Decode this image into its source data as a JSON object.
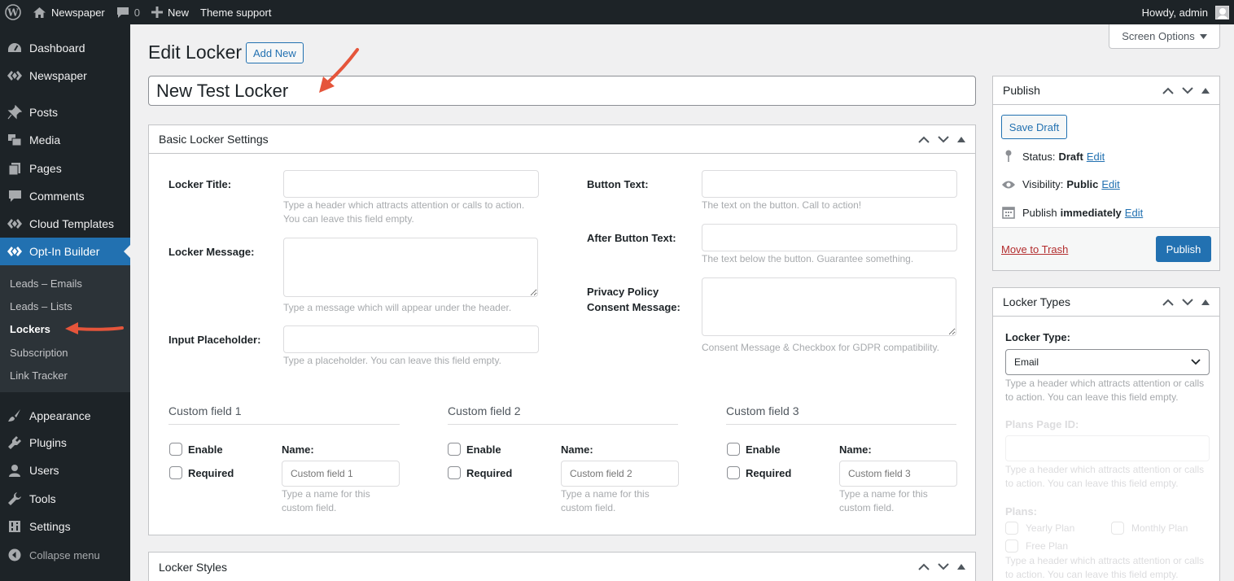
{
  "adminbar": {
    "site_name": "Newspaper",
    "comments_count": "0",
    "new_label": "New",
    "theme_support": "Theme support",
    "howdy": "Howdy, admin"
  },
  "sidebar": {
    "items": [
      {
        "label": "Dashboard",
        "icon": "dashboard-icon"
      },
      {
        "label": "Newspaper",
        "icon": "newspaper-icon"
      },
      {
        "label": "Posts",
        "icon": "pin-icon"
      },
      {
        "label": "Media",
        "icon": "media-icon"
      },
      {
        "label": "Pages",
        "icon": "pages-icon"
      },
      {
        "label": "Comments",
        "icon": "comment-icon"
      },
      {
        "label": "Cloud Templates",
        "icon": "cloud-templates-icon"
      },
      {
        "label": "Opt-In Builder",
        "icon": "optin-icon"
      },
      {
        "label": "Appearance",
        "icon": "brush-icon"
      },
      {
        "label": "Plugins",
        "icon": "plugin-icon"
      },
      {
        "label": "Users",
        "icon": "users-icon"
      },
      {
        "label": "Tools",
        "icon": "wrench-icon"
      },
      {
        "label": "Settings",
        "icon": "settings-icon"
      }
    ],
    "submenu": [
      "Leads – Emails",
      "Leads – Lists",
      "Lockers",
      "Subscription",
      "Link Tracker"
    ],
    "collapse": "Collapse menu"
  },
  "header": {
    "title": "Edit Locker",
    "add_new": "Add New",
    "screen_options": "Screen Options"
  },
  "post_title": "New Test Locker",
  "basic": {
    "title": "Basic Locker Settings",
    "locker_title": {
      "label": "Locker Title:",
      "hint1": "Type a header which attracts attention or calls to action.",
      "hint2": "You can leave this field empty."
    },
    "locker_message": {
      "label": "Locker Message:",
      "hint": "Type a message which will appear under the header."
    },
    "input_placeholder": {
      "label": "Input Placeholder:",
      "hint": "Type a placeholder. You can leave this field empty."
    },
    "button_text": {
      "label": "Button Text:",
      "hint": "The text on the button. Call to action!"
    },
    "after_button": {
      "label": "After Button Text:",
      "hint": "The text below the button. Guarantee something."
    },
    "privacy": {
      "label1": "Privacy Policy",
      "label2": "Consent Message:",
      "hint": "Consent Message & Checkbox for GDPR compatibility."
    },
    "custom_fields": [
      {
        "title": "Custom field 1",
        "placeholder": "Custom field 1"
      },
      {
        "title": "Custom field 2",
        "placeholder": "Custom field 2"
      },
      {
        "title": "Custom field 3",
        "placeholder": "Custom field 3"
      }
    ],
    "enable": "Enable",
    "required": "Required",
    "name": "Name:",
    "name_hint1": "Type a name for this",
    "name_hint2": "custom field."
  },
  "styles": {
    "title": "Locker Styles"
  },
  "publish": {
    "title": "Publish",
    "save_draft": "Save Draft",
    "status_label": "Status:",
    "status_value": "Draft",
    "visibility_label": "Visibility:",
    "visibility_value": "Public",
    "publish_label": "Publish",
    "publish_value": "immediately",
    "edit": "Edit",
    "trash": "Move to Trash",
    "publish_button": "Publish"
  },
  "types": {
    "title": "Locker Types",
    "type_label": "Locker Type:",
    "type_value": "Email",
    "hint1": "Type a header which attracts attention or calls",
    "hint2": "to action. You can leave this field empty.",
    "plans_page": "Plans Page ID:",
    "plans": "Plans:",
    "yearly": "Yearly Plan",
    "monthly": "Monthly Plan",
    "free": "Free Plan"
  }
}
